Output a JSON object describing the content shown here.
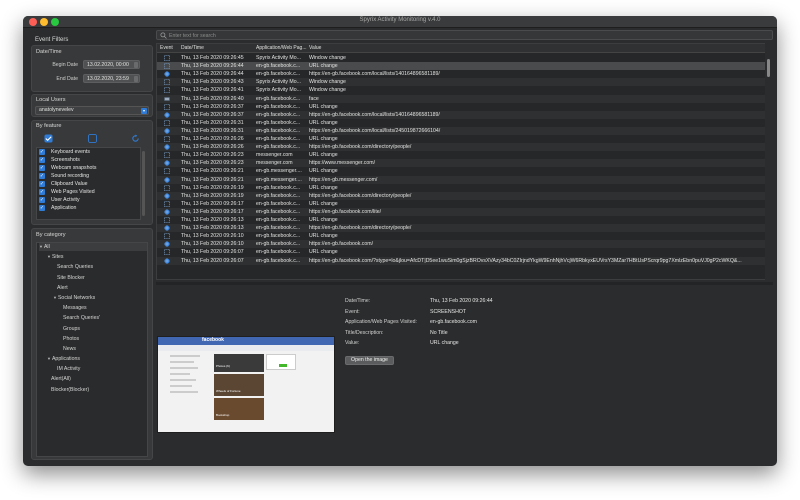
{
  "window": {
    "title": "Spyrix Activity Monitoring v.4.0"
  },
  "sidebar": {
    "event_filters": "Event Filters",
    "date_time": {
      "section": "Date/Time",
      "begin_label": "Begin Date",
      "begin_value": "13.02.2020, 00:00",
      "end_label": "End Date",
      "end_value": "13.02.2020, 23:59"
    },
    "local_users": {
      "section": "Local Users",
      "selected": "anatolynevelev"
    },
    "by_feature": {
      "section": "By feature",
      "items": [
        "Keyboard events",
        "Screenshots",
        "Webcam snapshots",
        "Sound recording",
        "Clipboard Value",
        "Web Pages Visited",
        "User Activity",
        "Application"
      ]
    },
    "by_category": {
      "section": "By category",
      "tree": [
        {
          "label": "All",
          "arrow": true
        },
        {
          "label": "Sites",
          "arrow": true
        },
        {
          "label": "Search Queries"
        },
        {
          "label": "Site Blocker"
        },
        {
          "label": "Alert"
        },
        {
          "label": "Social Networks",
          "arrow": true
        },
        {
          "label": "Messages"
        },
        {
          "label": "Search Queries'"
        },
        {
          "label": "Groups"
        },
        {
          "label": "Photos"
        },
        {
          "label": "News"
        },
        {
          "label": "Applications",
          "arrow": true
        },
        {
          "label": "IM Activity"
        },
        {
          "label": "Alert(All)"
        },
        {
          "label": "Blocker(Blocker)"
        }
      ]
    }
  },
  "search": {
    "placeholder": "Enter text for search"
  },
  "table": {
    "columns": [
      "Event",
      "Date/Time",
      "Application/Web Pag...",
      "Value"
    ],
    "rows": [
      {
        "icon": "screenshot",
        "date": "Thu, 13 Feb 2020 09:26:45",
        "app": "Spyrix Activity Mo...",
        "value": "Window change"
      },
      {
        "icon": "screenshot",
        "date": "Thu, 13 Feb 2020 09:26:44",
        "app": "en-gb.facebook.c...",
        "value": "URL change"
      },
      {
        "icon": "web",
        "date": "Thu, 13 Feb 2020 09:26:44",
        "app": "en-gb.facebook.c...",
        "value": "https://en-gb.facebook.com/local/lists/140164896581189/"
      },
      {
        "icon": "screenshot",
        "date": "Thu, 13 Feb 2020 09:26:43",
        "app": "Spyrix Activity Mo...",
        "value": "Window change"
      },
      {
        "icon": "screenshot",
        "date": "Thu, 13 Feb 2020 09:26:41",
        "app": "Spyrix Activity Mo...",
        "value": "Window change"
      },
      {
        "icon": "keyboard",
        "date": "Thu, 13 Feb 2020 09:26:40",
        "app": "en-gb.facebook.c...",
        "value": "face"
      },
      {
        "icon": "screenshot",
        "date": "Thu, 13 Feb 2020 09:26:37",
        "app": "en-gb.facebook.c...",
        "value": "URL change"
      },
      {
        "icon": "web",
        "date": "Thu, 13 Feb 2020 09:26:37",
        "app": "en-gb.facebook.c...",
        "value": "https://en-gb.facebook.com/local/lists/140164896581189/"
      },
      {
        "icon": "screenshot",
        "date": "Thu, 13 Feb 2020 09:26:31",
        "app": "en-gb.facebook.c...",
        "value": "URL change"
      },
      {
        "icon": "web",
        "date": "Thu, 13 Feb 2020 09:26:31",
        "app": "en-gb.facebook.c...",
        "value": "https://en-gb.facebook.com/local/lists/245019872666104/"
      },
      {
        "icon": "screenshot",
        "date": "Thu, 13 Feb 2020 09:26:26",
        "app": "en-gb.facebook.c...",
        "value": "URL change"
      },
      {
        "icon": "web",
        "date": "Thu, 13 Feb 2020 09:26:26",
        "app": "en-gb.facebook.c...",
        "value": "https://en-gb.facebook.com/directory/people/"
      },
      {
        "icon": "screenshot",
        "date": "Thu, 13 Feb 2020 09:26:23",
        "app": "messenger.com",
        "value": "URL change"
      },
      {
        "icon": "web",
        "date": "Thu, 13 Feb 2020 09:26:23",
        "app": "messenger.com",
        "value": "https://www.messenger.com/"
      },
      {
        "icon": "screenshot",
        "date": "Thu, 13 Feb 2020 09:26:21",
        "app": "en-gb.messenger....",
        "value": "URL change"
      },
      {
        "icon": "web",
        "date": "Thu, 13 Feb 2020 09:26:21",
        "app": "en-gb.messenger....",
        "value": "https://en-gb.messenger.com/"
      },
      {
        "icon": "screenshot",
        "date": "Thu, 13 Feb 2020 09:26:19",
        "app": "en-gb.facebook.c...",
        "value": "URL change"
      },
      {
        "icon": "web",
        "date": "Thu, 13 Feb 2020 09:26:19",
        "app": "en-gb.facebook.c...",
        "value": "https://en-gb.facebook.com/directory/people/"
      },
      {
        "icon": "screenshot",
        "date": "Thu, 13 Feb 2020 09:26:17",
        "app": "en-gb.facebook.c...",
        "value": "URL change"
      },
      {
        "icon": "web",
        "date": "Thu, 13 Feb 2020 09:26:17",
        "app": "en-gb.facebook.c...",
        "value": "https://en-gb.facebook.com/lite/"
      },
      {
        "icon": "screenshot",
        "date": "Thu, 13 Feb 2020 09:26:13",
        "app": "en-gb.facebook.c...",
        "value": "URL change"
      },
      {
        "icon": "web",
        "date": "Thu, 13 Feb 2020 09:26:13",
        "app": "en-gb.facebook.c...",
        "value": "https://en-gb.facebook.com/directory/people/"
      },
      {
        "icon": "screenshot",
        "date": "Thu, 13 Feb 2020 09:26:10",
        "app": "en-gb.facebook.c...",
        "value": "URL change"
      },
      {
        "icon": "web",
        "date": "Thu, 13 Feb 2020 09:26:10",
        "app": "en-gb.facebook.c...",
        "value": "https://en-gb.facebook.com/"
      },
      {
        "icon": "screenshot",
        "date": "Thu, 13 Feb 2020 09:26:07",
        "app": "en-gb.facebook.c...",
        "value": "URL change"
      },
      {
        "icon": "web",
        "date": "Thu, 13 Feb 2020 09:26:07",
        "app": "en-gb.facebook.c...",
        "value": "https://en-gb.facebook.com/?stype=lo&jlou=AfcDT|D5ee1wuSim0gSjzBROvsXVAzy34bC0ZIrjndYkgW9EnhNjhVcjW6RbkyxEUVrsY3MZar7HBtUsPScrqr9pg7XmlzEbn0puVJ0gP2cWKQ&..."
      }
    ]
  },
  "details": {
    "fields": [
      {
        "label": "Date/Time:",
        "value": "Thu, 13 Feb 2020 09:26:44"
      },
      {
        "label": "Event:",
        "value": "SCREENSHOT"
      },
      {
        "label": "Application/Web Pages Visited:",
        "value": "en-gb.facebook.com"
      },
      {
        "label": "Title/Description:",
        "value": "No Title"
      },
      {
        "label": "Value:",
        "value": "URL change"
      }
    ],
    "open_button": "Open the image",
    "thumbnail": {
      "brand": "facebook",
      "caption_1": "Photos (6)",
      "caption_2": "Wheels of Fortune",
      "caption_3": "Bookshop"
    }
  },
  "colors": {
    "accent": "#2f7bd6",
    "web_icon": "#2f7bd6",
    "screenshot_icon": "#6f8fb3"
  }
}
